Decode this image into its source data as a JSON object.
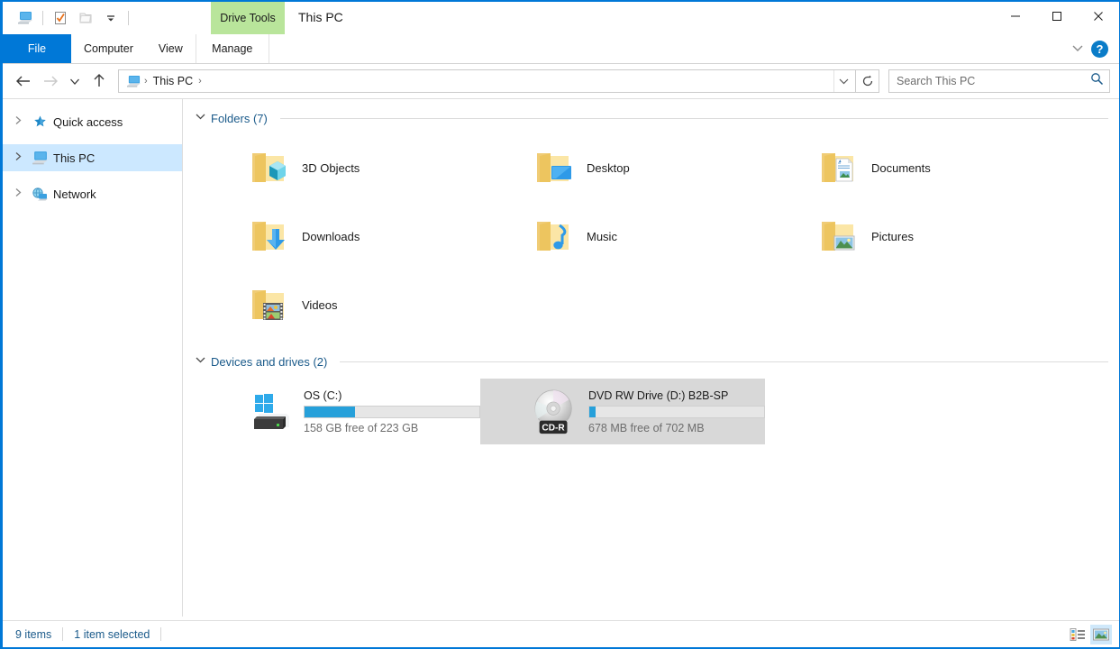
{
  "window": {
    "title": "This PC",
    "contextual_tab_group": "Drive Tools",
    "minimize_label": "Minimize",
    "maximize_label": "Maximize",
    "close_label": "Close"
  },
  "quick_access_toolbar": {
    "items": [
      {
        "name": "this-pc-icon",
        "label": "This PC"
      },
      {
        "name": "properties-icon",
        "label": "Properties"
      },
      {
        "name": "new-folder-icon",
        "label": "New folder"
      },
      {
        "name": "customize-dropdown-icon",
        "label": "Customize Quick Access Toolbar"
      }
    ]
  },
  "ribbon": {
    "tabs": [
      {
        "label": "File",
        "active": true
      },
      {
        "label": "Computer",
        "active": false
      },
      {
        "label": "View",
        "active": false
      },
      {
        "label": "Manage",
        "active": false
      }
    ],
    "expand_label": "Expand the Ribbon",
    "help_label": "?"
  },
  "navigation": {
    "back_label": "Back",
    "forward_label": "Forward",
    "recent_label": "Recent locations",
    "up_label": "Up",
    "refresh_label": "Refresh",
    "address": {
      "icon": "this-pc-icon",
      "crumbs": [
        "This PC"
      ],
      "separator": "›",
      "dropdown_label": "Previous locations"
    }
  },
  "search": {
    "placeholder": "Search This PC",
    "value": "",
    "icon": "search-icon"
  },
  "sidebar": {
    "items": [
      {
        "label": "Quick access",
        "icon": "star-icon",
        "selected": false,
        "expandable": true
      },
      {
        "label": "This PC",
        "icon": "this-pc-icon",
        "selected": true,
        "expandable": true
      },
      {
        "label": "Network",
        "icon": "network-icon",
        "selected": false,
        "expandable": true
      }
    ]
  },
  "main": {
    "groups": [
      {
        "title": "Folders (7)",
        "expanded": true,
        "items": [
          {
            "label": "3D Objects",
            "icon": "folder-3d-objects-icon"
          },
          {
            "label": "Desktop",
            "icon": "folder-desktop-icon"
          },
          {
            "label": "Documents",
            "icon": "folder-documents-icon"
          },
          {
            "label": "Downloads",
            "icon": "folder-downloads-icon"
          },
          {
            "label": "Music",
            "icon": "folder-music-icon"
          },
          {
            "label": "Pictures",
            "icon": "folder-pictures-icon"
          },
          {
            "label": "Videos",
            "icon": "folder-videos-icon"
          }
        ]
      },
      {
        "title": "Devices and drives (2)",
        "expanded": true,
        "drives": [
          {
            "name": "OS (C:)",
            "icon": "hard-drive-icon",
            "capacity_text": "158 GB free of 223 GB",
            "used_percent": 29,
            "selected": false
          },
          {
            "name": "DVD RW Drive (D:) B2B-SP",
            "icon": "optical-drive-icon",
            "badge": "CD-R",
            "capacity_text": "678 MB free of 702 MB",
            "used_percent": 3.5,
            "selected": true
          }
        ]
      }
    ]
  },
  "statusbar": {
    "item_count": "9 items",
    "selection": "1 item selected",
    "views": [
      {
        "name": "details-view-button",
        "label": "Details view",
        "active": false
      },
      {
        "name": "large-icons-view-button",
        "label": "Large icons view",
        "active": true
      }
    ]
  },
  "colors": {
    "accent": "#0078d7",
    "contextual_tab": "#b9e59b",
    "selection": "#cce8ff",
    "drive_selection": "#d8d8d8",
    "progress_blue": "#26a0da",
    "group_title": "#1a5a8a",
    "status_text": "#1a5a8a"
  }
}
